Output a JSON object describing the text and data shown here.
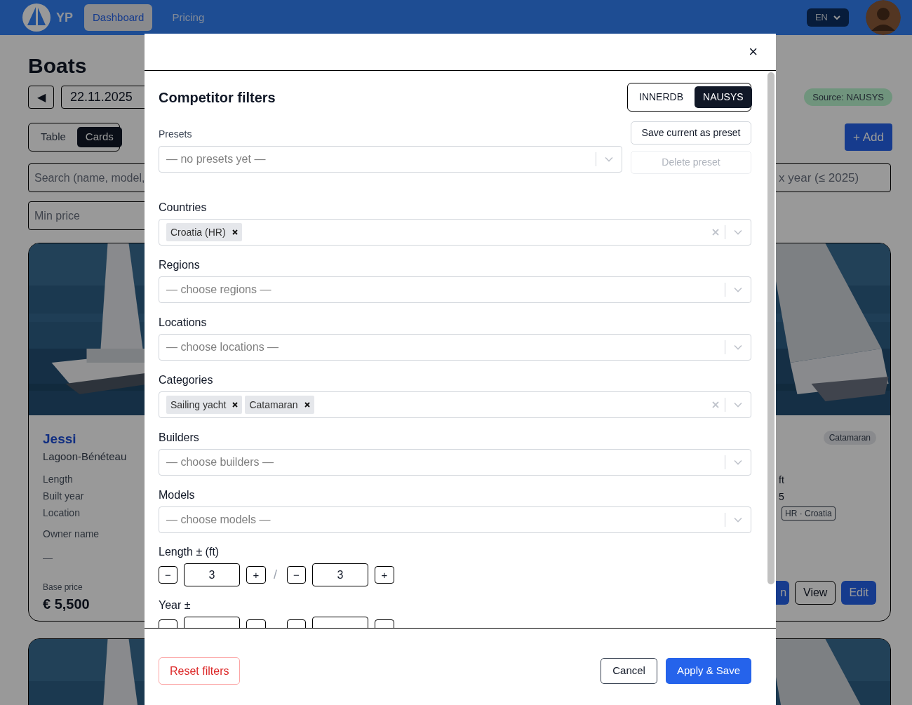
{
  "nav": {
    "brand": "YP",
    "links": [
      {
        "label": "Dashboard",
        "selected": true
      },
      {
        "label": "Pricing",
        "selected": false
      }
    ],
    "language": "EN"
  },
  "page": {
    "title": "Boats",
    "prev_button": "◀",
    "date": "22.11.2025",
    "source_badge": "Source: NAUSYS",
    "view_toggle": [
      {
        "label": "Table",
        "selected": false
      },
      {
        "label": "Cards",
        "selected": true
      }
    ],
    "add_button": "+ Add",
    "search_placeholder": "Search (name, model,",
    "max_year_placeholder": "x year (≤ 2025)",
    "min_price_placeholder": "Min price"
  },
  "cards": [
    {
      "name": "Jessi",
      "model": "Lagoon-Bénéteau",
      "specs": [
        "Length",
        "Built year",
        "Location",
        "Owner name"
      ],
      "owner_value": "—",
      "price_label": "Base price",
      "price": "€ 5,500"
    },
    {
      "category": "Catamaran",
      "values": [
        "ft",
        "5"
      ],
      "location": "HR · Croatia",
      "buttons": [
        {
          "label": "n",
          "kind": "primary"
        },
        {
          "label": "View",
          "kind": "outline"
        },
        {
          "label": "Edit",
          "kind": "primary"
        }
      ]
    },
    {
      "kind": "picture"
    },
    {
      "kind": "picture"
    }
  ],
  "modal": {
    "close": "×",
    "title": "Competitor filters",
    "sources": [
      {
        "label": "INNERDB",
        "selected": false
      },
      {
        "label": "NAUSYS",
        "selected": true
      }
    ],
    "presets": {
      "label": "Presets",
      "placeholder": "— no presets yet —",
      "save_button": "Save current as preset",
      "delete_button": "Delete preset",
      "delete_disabled": true
    },
    "filters": [
      {
        "label": "Countries",
        "chips": [
          "Croatia (HR)"
        ]
      },
      {
        "label": "Regions",
        "placeholder": "— choose regions —"
      },
      {
        "label": "Locations",
        "placeholder": "— choose locations —"
      },
      {
        "label": "Categories",
        "chips": [
          "Sailing yacht",
          "Catamaran"
        ]
      },
      {
        "label": "Builders",
        "placeholder": "— choose builders —"
      },
      {
        "label": "Models",
        "placeholder": "— choose models —"
      }
    ],
    "steppers": [
      {
        "label": "Length ± (ft)",
        "decrement": "−",
        "increment": "+",
        "separator": "/",
        "values": [
          "3",
          "3"
        ]
      },
      {
        "label": "Year ±"
      }
    ],
    "reset_button": "Reset filters",
    "cancel_button": "Cancel",
    "apply_button": "Apply & Save"
  }
}
